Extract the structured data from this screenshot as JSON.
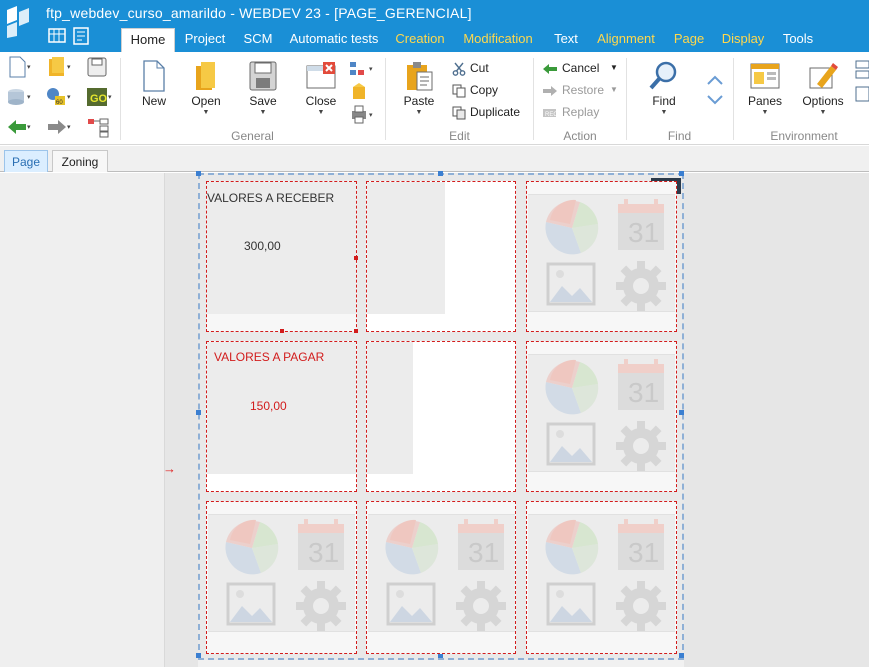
{
  "window": {
    "title": "ftp_webdev_curso_amarildo - WEBDEV 23 - [PAGE_GERENCIAL]"
  },
  "ribbon_tabs": [
    {
      "label": "Home",
      "active": true
    },
    {
      "label": "Project"
    },
    {
      "label": "SCM"
    },
    {
      "label": "Automatic tests"
    },
    {
      "label": "Creation",
      "color": "yellow"
    },
    {
      "label": "Modification",
      "color": "yellow"
    },
    {
      "label": "Text"
    },
    {
      "label": "Alignment",
      "color": "yellow"
    },
    {
      "label": "Page",
      "color": "yellow"
    },
    {
      "label": "Display",
      "color": "yellow"
    },
    {
      "label": "Tools"
    }
  ],
  "ribbon": {
    "general": {
      "label": "General",
      "new": "New",
      "open": "Open",
      "save": "Save",
      "close": "Close"
    },
    "edit": {
      "label": "Edit",
      "paste": "Paste",
      "cut": "Cut",
      "copy": "Copy",
      "duplicate": "Duplicate"
    },
    "action": {
      "label": "Action",
      "cancel": "Cancel",
      "restore": "Restore",
      "replay": "Replay"
    },
    "find": {
      "label": "Find",
      "find": "Find"
    },
    "environment": {
      "label": "Environment",
      "panes": "Panes",
      "options": "Options"
    }
  },
  "subtabs": [
    {
      "label": "Page",
      "active": true
    },
    {
      "label": "Zoning"
    }
  ],
  "page_cells": {
    "receber": {
      "label": "VALORES A RECEBER",
      "value": "300,00",
      "color": "#333333"
    },
    "pagar": {
      "label": "VALORES A PAGAR",
      "value": "150,00",
      "color": "#d21c1c"
    },
    "placeholder_calendar_number": "31"
  },
  "colors": {
    "titlebar": "#1a8fd6",
    "accent_yellow": "#ffd84d",
    "selection_red": "#d21c1c"
  }
}
